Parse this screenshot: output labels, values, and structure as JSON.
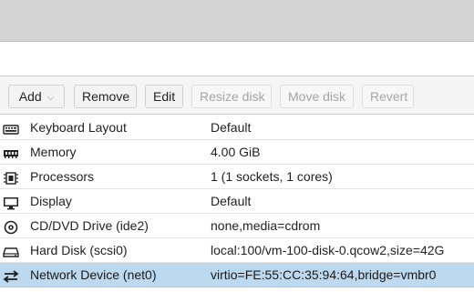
{
  "toolbar": {
    "add_label": "Add",
    "remove_label": "Remove",
    "edit_label": "Edit",
    "resize_label": "Resize disk",
    "move_label": "Move disk",
    "revert_label": "Revert"
  },
  "hardware": [
    {
      "icon": "keyboard-icon",
      "key": "Keyboard Layout",
      "value": "Default"
    },
    {
      "icon": "memory-icon",
      "key": "Memory",
      "value": "4.00 GiB"
    },
    {
      "icon": "cpu-icon",
      "key": "Processors",
      "value": "1 (1 sockets, 1 cores)"
    },
    {
      "icon": "monitor-icon",
      "key": "Display",
      "value": "Default"
    },
    {
      "icon": "cdrom-icon",
      "key": "CD/DVD Drive (ide2)",
      "value": "none,media=cdrom"
    },
    {
      "icon": "harddisk-icon",
      "key": "Hard Disk (scsi0)",
      "value": "local:100/vm-100-disk-0.qcow2,size=42G"
    },
    {
      "icon": "network-icon",
      "key": "Network Device (net0)",
      "value": "virtio=FE:55:CC:35:94:64,bridge=vmbr0",
      "selected": true
    }
  ]
}
